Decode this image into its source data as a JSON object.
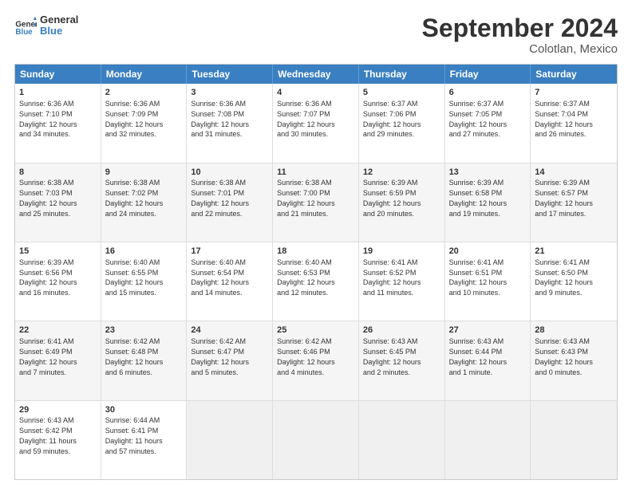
{
  "header": {
    "logo": {
      "general": "General",
      "blue": "Blue"
    },
    "title": "September 2024",
    "location": "Colotlan, Mexico"
  },
  "weekdays": [
    "Sunday",
    "Monday",
    "Tuesday",
    "Wednesday",
    "Thursday",
    "Friday",
    "Saturday"
  ],
  "rows": [
    [
      {
        "day": "",
        "info": ""
      },
      {
        "day": "2",
        "info": "Sunrise: 6:36 AM\nSunset: 7:09 PM\nDaylight: 12 hours\nand 32 minutes."
      },
      {
        "day": "3",
        "info": "Sunrise: 6:36 AM\nSunset: 7:08 PM\nDaylight: 12 hours\nand 31 minutes."
      },
      {
        "day": "4",
        "info": "Sunrise: 6:36 AM\nSunset: 7:07 PM\nDaylight: 12 hours\nand 30 minutes."
      },
      {
        "day": "5",
        "info": "Sunrise: 6:37 AM\nSunset: 7:06 PM\nDaylight: 12 hours\nand 29 minutes."
      },
      {
        "day": "6",
        "info": "Sunrise: 6:37 AM\nSunset: 7:05 PM\nDaylight: 12 hours\nand 27 minutes."
      },
      {
        "day": "7",
        "info": "Sunrise: 6:37 AM\nSunset: 7:04 PM\nDaylight: 12 hours\nand 26 minutes."
      }
    ],
    [
      {
        "day": "1",
        "info": "Sunrise: 6:36 AM\nSunset: 7:10 PM\nDaylight: 12 hours\nand 34 minutes."
      },
      {
        "day": "9",
        "info": "Sunrise: 6:38 AM\nSunset: 7:02 PM\nDaylight: 12 hours\nand 24 minutes."
      },
      {
        "day": "10",
        "info": "Sunrise: 6:38 AM\nSunset: 7:01 PM\nDaylight: 12 hours\nand 22 minutes."
      },
      {
        "day": "11",
        "info": "Sunrise: 6:38 AM\nSunset: 7:00 PM\nDaylight: 12 hours\nand 21 minutes."
      },
      {
        "day": "12",
        "info": "Sunrise: 6:39 AM\nSunset: 6:59 PM\nDaylight: 12 hours\nand 20 minutes."
      },
      {
        "day": "13",
        "info": "Sunrise: 6:39 AM\nSunset: 6:58 PM\nDaylight: 12 hours\nand 19 minutes."
      },
      {
        "day": "14",
        "info": "Sunrise: 6:39 AM\nSunset: 6:57 PM\nDaylight: 12 hours\nand 17 minutes."
      }
    ],
    [
      {
        "day": "8",
        "info": "Sunrise: 6:38 AM\nSunset: 7:03 PM\nDaylight: 12 hours\nand 25 minutes."
      },
      {
        "day": "16",
        "info": "Sunrise: 6:40 AM\nSunset: 6:55 PM\nDaylight: 12 hours\nand 15 minutes."
      },
      {
        "day": "17",
        "info": "Sunrise: 6:40 AM\nSunset: 6:54 PM\nDaylight: 12 hours\nand 14 minutes."
      },
      {
        "day": "18",
        "info": "Sunrise: 6:40 AM\nSunset: 6:53 PM\nDaylight: 12 hours\nand 12 minutes."
      },
      {
        "day": "19",
        "info": "Sunrise: 6:41 AM\nSunset: 6:52 PM\nDaylight: 12 hours\nand 11 minutes."
      },
      {
        "day": "20",
        "info": "Sunrise: 6:41 AM\nSunset: 6:51 PM\nDaylight: 12 hours\nand 10 minutes."
      },
      {
        "day": "21",
        "info": "Sunrise: 6:41 AM\nSunset: 6:50 PM\nDaylight: 12 hours\nand 9 minutes."
      }
    ],
    [
      {
        "day": "15",
        "info": "Sunrise: 6:39 AM\nSunset: 6:56 PM\nDaylight: 12 hours\nand 16 minutes."
      },
      {
        "day": "23",
        "info": "Sunrise: 6:42 AM\nSunset: 6:48 PM\nDaylight: 12 hours\nand 6 minutes."
      },
      {
        "day": "24",
        "info": "Sunrise: 6:42 AM\nSunset: 6:47 PM\nDaylight: 12 hours\nand 5 minutes."
      },
      {
        "day": "25",
        "info": "Sunrise: 6:42 AM\nSunset: 6:46 PM\nDaylight: 12 hours\nand 4 minutes."
      },
      {
        "day": "26",
        "info": "Sunrise: 6:43 AM\nSunset: 6:45 PM\nDaylight: 12 hours\nand 2 minutes."
      },
      {
        "day": "27",
        "info": "Sunrise: 6:43 AM\nSunset: 6:44 PM\nDaylight: 12 hours\nand 1 minute."
      },
      {
        "day": "28",
        "info": "Sunrise: 6:43 AM\nSunset: 6:43 PM\nDaylight: 12 hours\nand 0 minutes."
      }
    ],
    [
      {
        "day": "22",
        "info": "Sunrise: 6:41 AM\nSunset: 6:49 PM\nDaylight: 12 hours\nand 7 minutes."
      },
      {
        "day": "30",
        "info": "Sunrise: 6:44 AM\nSunset: 6:41 PM\nDaylight: 11 hours\nand 57 minutes."
      },
      {
        "day": "",
        "info": ""
      },
      {
        "day": "",
        "info": ""
      },
      {
        "day": "",
        "info": ""
      },
      {
        "day": "",
        "info": ""
      },
      {
        "day": "",
        "info": ""
      }
    ],
    [
      {
        "day": "29",
        "info": "Sunrise: 6:43 AM\nSunset: 6:42 PM\nDaylight: 11 hours\nand 59 minutes."
      },
      {
        "day": "",
        "info": ""
      },
      {
        "day": "",
        "info": ""
      },
      {
        "day": "",
        "info": ""
      },
      {
        "day": "",
        "info": ""
      },
      {
        "day": "",
        "info": ""
      },
      {
        "day": "",
        "info": ""
      }
    ]
  ]
}
